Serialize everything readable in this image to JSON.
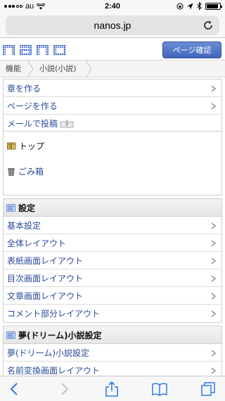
{
  "statusbar": {
    "carrier": "au",
    "time": "2:40"
  },
  "browser": {
    "url": "nanos.jp"
  },
  "header": {
    "logo_text": "nano",
    "page_confirm_label": "ページ確認"
  },
  "breadcrumb": {
    "items": [
      "機能",
      "小説(小説)"
    ]
  },
  "actions": {
    "items": [
      "章を作る",
      "ページを作る"
    ],
    "mail_post": "メールで投稿",
    "help": "?"
  },
  "tree": {
    "top_label": "トップ",
    "trash_label": "ごみ箱"
  },
  "settings": {
    "title": "設定",
    "items": [
      "基本設定",
      "全体レイアウト",
      "表紙画面レイアウト",
      "目次画面レイアウト",
      "文章画面レイアウト",
      "コメント部分レイアウト"
    ]
  },
  "dream": {
    "title": "夢(ドリーム)小説設定",
    "items": [
      "夢(ドリーム)小説設定",
      "名前変換画面レイアウト"
    ]
  },
  "colors": {
    "accent": "#3f66bb",
    "link": "#2a4a9a",
    "toolbar_blue": "#2f7ae5"
  }
}
